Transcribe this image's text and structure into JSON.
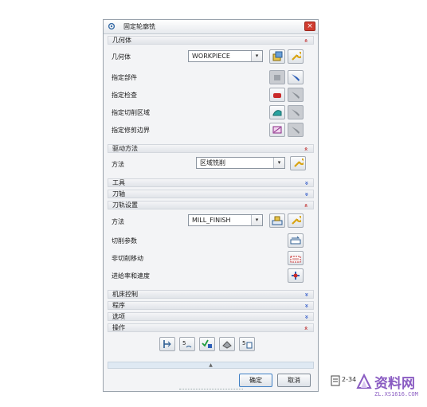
{
  "dialog": {
    "title": "固定轮廓铣",
    "close_symbol": "×"
  },
  "sections": {
    "geometry": {
      "title": "几何体",
      "expanded": true
    },
    "drive": {
      "title": "驱动方法",
      "expanded": true
    },
    "tool": {
      "title": "工具",
      "expanded": false
    },
    "axis": {
      "title": "刀轴",
      "expanded": false
    },
    "path": {
      "title": "刀轨设置",
      "expanded": true
    },
    "machine": {
      "title": "机床控制",
      "expanded": false
    },
    "program": {
      "title": "程序",
      "expanded": false
    },
    "options": {
      "title": "选项",
      "expanded": false
    },
    "actions": {
      "title": "操作",
      "expanded": true
    }
  },
  "chevrons": {
    "up": "»",
    "down": "»"
  },
  "geometry": {
    "geometry_label": "几何体",
    "geometry_value": "WORKPIECE",
    "part_label": "指定部件",
    "check_label": "指定检查",
    "cut_area_label": "指定切削区域",
    "trim_label": "指定修剪边界"
  },
  "drive": {
    "method_label": "方法",
    "method_value": "区域铣削"
  },
  "path": {
    "method_label": "方法",
    "method_value": "MILL_FINISH",
    "cut_params_label": "切削参数",
    "non_cut_label": "非切削移动",
    "feeds_label": "进给率和速度"
  },
  "footer": {
    "ok_label": "确定",
    "cancel_label": "取消",
    "expand_symbol": "▲"
  },
  "side": {
    "fragment": "2-34",
    "watermark_brand": "资料网",
    "watermark_url": "ZL.XS1616.COM"
  },
  "colors": {
    "accent": "#2a55c8",
    "close": "#d03c2f",
    "watermark": "#8a5cc2"
  }
}
